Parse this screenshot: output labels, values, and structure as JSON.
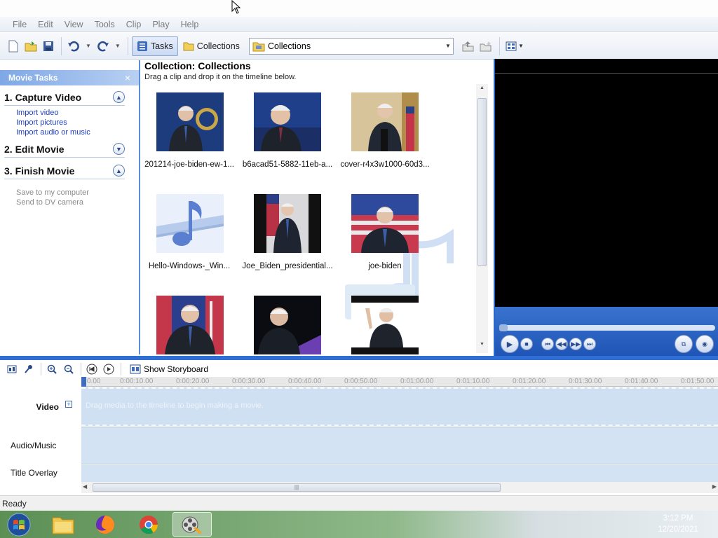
{
  "menu": [
    "File",
    "Edit",
    "View",
    "Tools",
    "Clip",
    "Play",
    "Help"
  ],
  "toolbar": {
    "tasks_label": "Tasks",
    "collections_label": "Collections",
    "collection_dropdown_value": "Collections"
  },
  "tasks_pane": {
    "header": "Movie Tasks",
    "close_glyph": "×",
    "sections": [
      {
        "title": "1. Capture Video",
        "expanded": true,
        "links": [
          "Import video",
          "Import pictures",
          "Import audio or music"
        ]
      },
      {
        "title": "2. Edit Movie",
        "expanded": false,
        "links": []
      },
      {
        "title": "3. Finish Movie",
        "expanded": true,
        "links": [
          "Save to my computer",
          "Send to DV camera"
        ]
      }
    ]
  },
  "collection": {
    "title": "Collection: Collections",
    "hint": "Drag a clip and drop it on the timeline below.",
    "items": [
      {
        "label": "201214-joe-biden-ew-1..."
      },
      {
        "label": "b6acad51-5882-11eb-a..."
      },
      {
        "label": "cover-r4x3w1000-60d3..."
      },
      {
        "label": "Hello-Windows-_Win..."
      },
      {
        "label": "Joe_Biden_presidential..."
      },
      {
        "label": "joe-biden"
      },
      {
        "label": ""
      },
      {
        "label": ""
      },
      {
        "label": ""
      }
    ]
  },
  "timeline": {
    "storyboard_label": "Show Storyboard",
    "ticks": [
      "0.00",
      "0:00:10.00",
      "0:00:20.00",
      "0:00:30.00",
      "0:00:40.00",
      "0:00:50.00",
      "0:01:00.00",
      "0:01:10.00",
      "0:01:20.00",
      "0:01:30.00",
      "0:01:40.00",
      "0:01:50.00"
    ],
    "video_label": "Video",
    "video_hint": "Drag media to the timeline to begin making a movie.",
    "audio_label": "Audio/Music",
    "title_label": "Title Overlay"
  },
  "status": {
    "text": "Ready"
  },
  "clock": {
    "time": "3:12 PM",
    "date": "12/20/2021"
  },
  "colors": {
    "accent": "#2f6fd5",
    "link": "#1f3fbf",
    "track": "#d4e3f4"
  }
}
